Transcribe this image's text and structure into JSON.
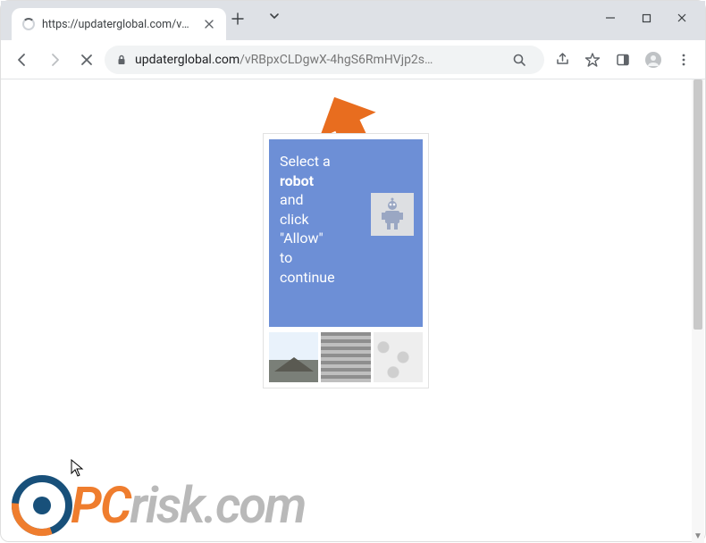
{
  "tab": {
    "title": "https://updaterglobal.com/vRBpx"
  },
  "address": {
    "host": "updaterglobal.com",
    "path": "/vRBpxCLDgwX-4hgS6RmHVjp2s…"
  },
  "captcha": {
    "line1": "Select a",
    "line2_bold": "robot",
    "line3": "and",
    "line4": "click",
    "line5": "\"Allow\"",
    "line6": "to",
    "line7": "continue"
  },
  "watermark": {
    "prefix": "PC",
    "rest": "risk.com"
  }
}
